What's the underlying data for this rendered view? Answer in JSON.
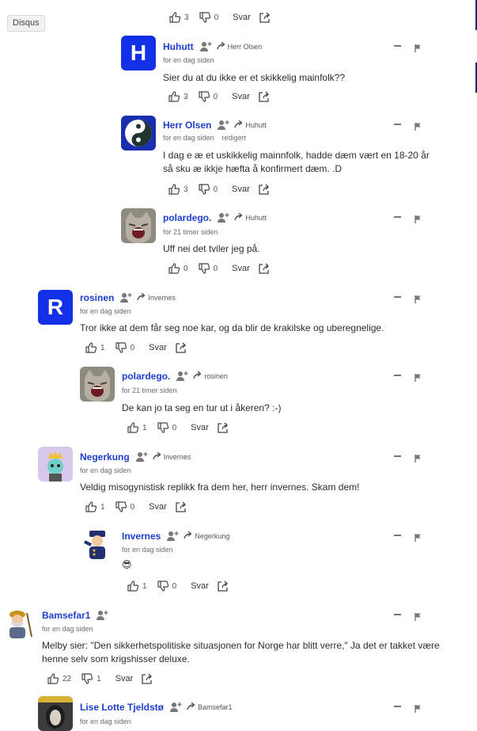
{
  "tooltip": "Disqus",
  "labels": {
    "reply": "Svar"
  },
  "colors": {
    "author": "#1d3fd0",
    "avatar_letter_bg": "#1230e6",
    "edge_bar": "#1d2a70"
  },
  "top_actions": {
    "upvotes": "3",
    "downvotes": "0"
  },
  "comments": [
    {
      "author": "Huhutt",
      "reply_to": "Herr Olsen",
      "timestamp": "for en dag siden",
      "edited": "",
      "avatar_letter": "H",
      "avatar": "letter-icon",
      "text": "Sier du at du ikke er et skikkelig mainfolk??",
      "upvotes": "3",
      "downvotes": "0"
    },
    {
      "author": "Herr Olsen",
      "reply_to": "Huhutt",
      "timestamp": "for en dag siden",
      "edited": "redigert",
      "avatar": "yin-yang-avatar",
      "text": "I dag e æ et uskikkelig mainnfolk, hadde dæm vært en 18-20 år så sku æ ikkje hæfta å konfirmert dæm. .D",
      "upvotes": "3",
      "downvotes": "0"
    },
    {
      "author": "polardego.",
      "reply_to": "Huhutt",
      "timestamp": "for 21 timer siden",
      "edited": "",
      "avatar": "cat-avatar",
      "text": "Uff nei det tviler jeg på.",
      "upvotes": "0",
      "downvotes": "0"
    },
    {
      "author": "rosinen",
      "reply_to": "Invernes",
      "timestamp": "for en dag siden",
      "edited": "",
      "avatar_letter": "R",
      "avatar": "letter-icon",
      "text": "Tror ikke at dem får seg noe kar, og da blir de krakilske og uberegnelige.",
      "upvotes": "1",
      "downvotes": "0"
    },
    {
      "author": "polardego.",
      "reply_to": "rosinen",
      "timestamp": "for 21 timer siden",
      "edited": "",
      "avatar": "cat-avatar",
      "text": "De kan jo ta seg en tur ut i åkeren? :-)",
      "upvotes": "1",
      "downvotes": "0"
    },
    {
      "author": "Negerkung",
      "reply_to": "Invernes",
      "timestamp": "for en dag siden",
      "edited": "",
      "avatar": "king-avatar",
      "text": "Veldig misogynistisk replikk fra dem her, herr invernes. Skam dem!",
      "upvotes": "1",
      "downvotes": "0"
    },
    {
      "author": "Invernes",
      "reply_to": "Negerkung",
      "timestamp": "for en dag siden",
      "edited": "",
      "avatar": "police-avatar",
      "text": "😎",
      "upvotes": "1",
      "downvotes": "0"
    },
    {
      "author": "Bamsefar1",
      "reply_to": "",
      "timestamp": "for en dag siden",
      "edited": "",
      "avatar": "fisherman-avatar",
      "text": "Melby sier: \"Den sikkerhetspolitiske situasjonen for Norge har blitt verre,\" Ja det er takket være henne selv som krigshisser deluxe.",
      "upvotes": "22",
      "downvotes": "1"
    },
    {
      "author": "Lise Lotte Tjeldstø",
      "reply_to": "Bamsefar1",
      "timestamp": "for en dag siden",
      "edited": "",
      "avatar": "portrait-avatar",
      "text": "",
      "upvotes": "",
      "downvotes": ""
    }
  ]
}
